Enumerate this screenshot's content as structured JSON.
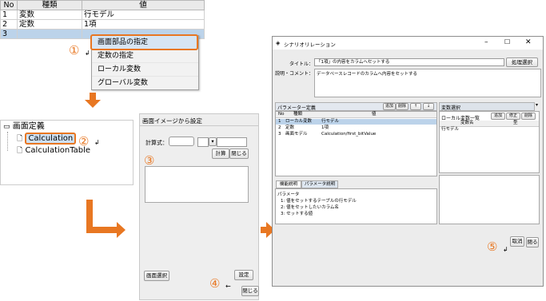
{
  "panel1": {
    "columns": [
      "No",
      "種類",
      "値"
    ],
    "rows": [
      {
        "no": "1",
        "type": "変数",
        "value": "行モデル"
      },
      {
        "no": "2",
        "type": "定数",
        "value": "1項"
      },
      {
        "no": "3",
        "type": "",
        "value": ""
      }
    ],
    "menu": [
      "画面部品の指定",
      "定数の指定",
      "ローカル変数",
      "グローバル変数"
    ],
    "step": "①"
  },
  "panel2": {
    "root": "画面定義",
    "items": [
      "Calculation",
      "CalculationTable"
    ],
    "step": "②"
  },
  "panel3": {
    "title": "画面イメージから設定",
    "calc_label": "計算式：",
    "calc_button": "計算",
    "close_button": "閉じる",
    "screen_select_button": "画面選択",
    "set_button": "設定",
    "close_bottom_button": "閉じる",
    "step3": "③",
    "step4": "④"
  },
  "panel4": {
    "title": "シナリオリレーション",
    "title_label": "タイトル：",
    "title_value": "「1項」の内容をカラムへセットする",
    "title_button": "処理選択",
    "desc_label": "説明・コメント：",
    "desc_value": "データベースレコードのカラムへ内容をセットする",
    "param_header": "パラメーター定義",
    "param_buttons": [
      "追加",
      "削除",
      "↑",
      "↓"
    ],
    "param_columns": [
      "No",
      "種類",
      "値"
    ],
    "param_rows": [
      {
        "no": "1",
        "type": "ローカル変数",
        "value": "行モデル"
      },
      {
        "no": "2",
        "type": "定数",
        "value": "1項"
      },
      {
        "no": "3",
        "type": "画面モデル",
        "value": "Calculation/first_bitValue"
      }
    ],
    "var_select": "変数選択",
    "local_var_list": "ローカル変数一覧",
    "var_buttons": [
      "追加",
      "修正",
      "削除"
    ],
    "var_columns": [
      "変数名",
      "型"
    ],
    "var_rows": [
      "行モデル"
    ],
    "tabs": [
      "機能説明",
      "パラメータ説明"
    ],
    "param_desc_title": "パラメータ",
    "param_desc_lines": [
      "1: 値をセットするテーブルの行モデル",
      "2: 値をセットしたいカラム名",
      "3: セットする値"
    ],
    "ok_button": "取消",
    "close_button": "閉る",
    "step": "⑤"
  },
  "colors": {
    "accent": "#e87722",
    "selection": "#bcd3ea"
  }
}
